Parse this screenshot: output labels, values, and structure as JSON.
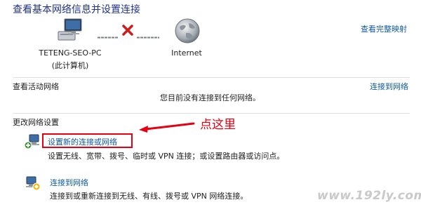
{
  "header": {
    "title": "查看基本网络信息并设置连接",
    "view_full_map": "查看完整映射"
  },
  "network_map": {
    "computer_name": "TETENG-SEO-PC",
    "computer_sub": "(此计算机)",
    "internet_label": "Internet",
    "link_status": "disconnected"
  },
  "active_networks": {
    "label": "查看活动网络",
    "connect_link": "连接到网络",
    "status": "您目前没有连接到任何网络。"
  },
  "change_settings": {
    "label": "更改网络设置",
    "items": [
      {
        "title": "设置新的连接或网络",
        "description": "设置无线、宽带、拨号、临时或 VPN 连接；或设置路由器或访问点。"
      },
      {
        "title": "连接到网络",
        "description": "连接到或重新连接到无线、有线、拨号或 VPN 网络连接。"
      }
    ]
  },
  "annotation": {
    "text": "点这里"
  },
  "watermark": {
    "text": "www.192ly.com"
  },
  "colors": {
    "title": "#1e3287",
    "link": "#0f5aa0",
    "highlight": "#e60012",
    "disconnect_x": "#d11a1a"
  },
  "icons": [
    "computer-icon",
    "globe-icon",
    "disconnect-x-icon",
    "new-connection-icon",
    "connect-network-icon"
  ]
}
